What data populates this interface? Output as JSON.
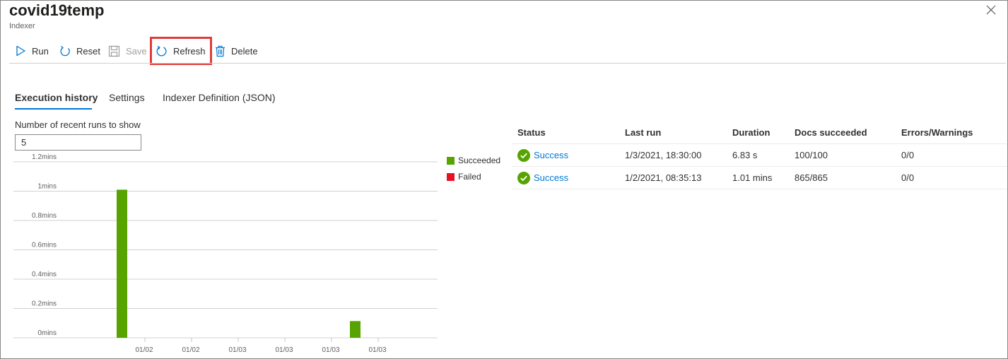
{
  "header": {
    "title": "covid19temp",
    "subtitle": "Indexer"
  },
  "toolbar": {
    "run_label": "Run",
    "reset_label": "Reset",
    "save_label": "Save",
    "refresh_label": "Refresh",
    "delete_label": "Delete"
  },
  "tabs": [
    {
      "label": "Execution history",
      "active": true
    },
    {
      "label": "Settings",
      "active": false
    },
    {
      "label": "Indexer Definition (JSON)",
      "active": false
    }
  ],
  "runs": {
    "label": "Number of recent runs to show",
    "value": "5"
  },
  "legend": [
    {
      "label": "Succeeded",
      "color": "#57a300"
    },
    {
      "label": "Failed",
      "color": "#e81123"
    }
  ],
  "chart_data": {
    "type": "bar",
    "categories": [
      "01/02",
      "01/02",
      "01/03",
      "01/03",
      "01/03",
      "01/03"
    ],
    "series": [
      {
        "name": "Succeeded",
        "color": "#57a300",
        "values": [
          1.01,
          0,
          0,
          0,
          0,
          0.114
        ]
      },
      {
        "name": "Failed",
        "color": "#e81123",
        "values": [
          0,
          0,
          0,
          0,
          0,
          0
        ]
      }
    ],
    "yticks": [
      "1.2mins",
      "1mins",
      "0.8mins",
      "0.6mins",
      "0.4mins",
      "0.2mins",
      "0mins"
    ],
    "ylim": [
      0,
      1.2
    ],
    "grid": true,
    "legend_position": "right"
  },
  "table": {
    "columns": [
      "Status",
      "Last run",
      "Duration",
      "Docs succeeded",
      "Errors/Warnings"
    ],
    "rows": [
      {
        "status": "Success",
        "last_run": "1/3/2021, 18:30:00",
        "duration": "6.83 s",
        "docs": "100/100",
        "errors": "0/0"
      },
      {
        "status": "Success",
        "last_run": "1/2/2021, 08:35:13",
        "duration": "1.01 mins",
        "docs": "865/865",
        "errors": "0/0"
      }
    ]
  },
  "colors": {
    "accent": "#0078d4",
    "success": "#57a300",
    "highlight": "#e03c3c"
  }
}
